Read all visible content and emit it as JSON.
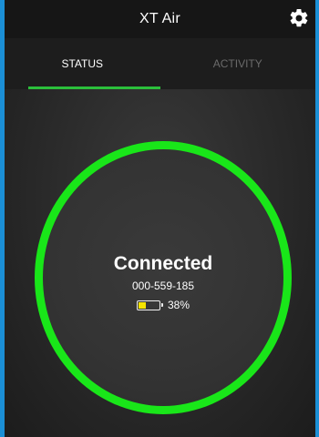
{
  "header": {
    "title": "XT Air",
    "settings_icon": "gear-icon"
  },
  "tabs": [
    {
      "label": "STATUS",
      "active": true
    },
    {
      "label": "ACTIVITY",
      "active": false
    }
  ],
  "device": {
    "status": "Connected",
    "id": "000-559-185",
    "battery_label": "38%",
    "battery_level": 0.38,
    "ring_color": "#19e619",
    "battery_fill_color": "#f5e400"
  },
  "colors": {
    "accent_underline": "#2bbf3b",
    "frame_border": "#1b8fd6"
  }
}
